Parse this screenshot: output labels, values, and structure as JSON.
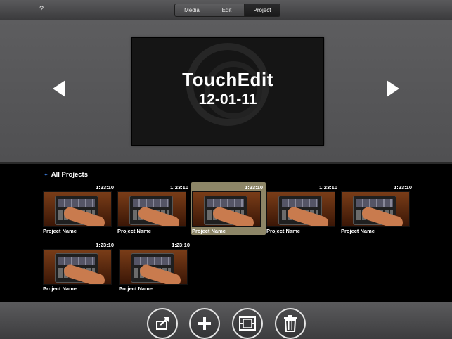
{
  "topbar": {
    "help_label": "?",
    "tabs": [
      {
        "label": "Media",
        "active": false
      },
      {
        "label": "Edit",
        "active": false
      },
      {
        "label": "Project",
        "active": true
      }
    ]
  },
  "preview": {
    "title": "TouchEdit",
    "date": "12-01-11",
    "prev_icon": "left-triangle-icon",
    "next_icon": "right-triangle-icon"
  },
  "projects": {
    "section_title": "All Projects",
    "section_marker_icon": "blue-star-icon",
    "items": [
      {
        "duration": "1:23:10",
        "name": "Project Name",
        "selected": false
      },
      {
        "duration": "1:23:10",
        "name": "Project Name",
        "selected": false
      },
      {
        "duration": "1:23:10",
        "name": "Project Name",
        "selected": true
      },
      {
        "duration": "1:23:10",
        "name": "Project Name",
        "selected": false
      },
      {
        "duration": "1:23:10",
        "name": "Project Name",
        "selected": false
      },
      {
        "duration": "1:23:10",
        "name": "Project Name",
        "selected": false
      },
      {
        "duration": "1:23:10",
        "name": "Project Name",
        "selected": false
      }
    ]
  },
  "toolbar": {
    "buttons": [
      {
        "icon": "share-icon"
      },
      {
        "icon": "plus-icon"
      },
      {
        "icon": "duplicate-icon"
      },
      {
        "icon": "trash-icon"
      }
    ]
  },
  "colors": {
    "selection": "#8d8667",
    "accent_star": "#3b7de0"
  }
}
